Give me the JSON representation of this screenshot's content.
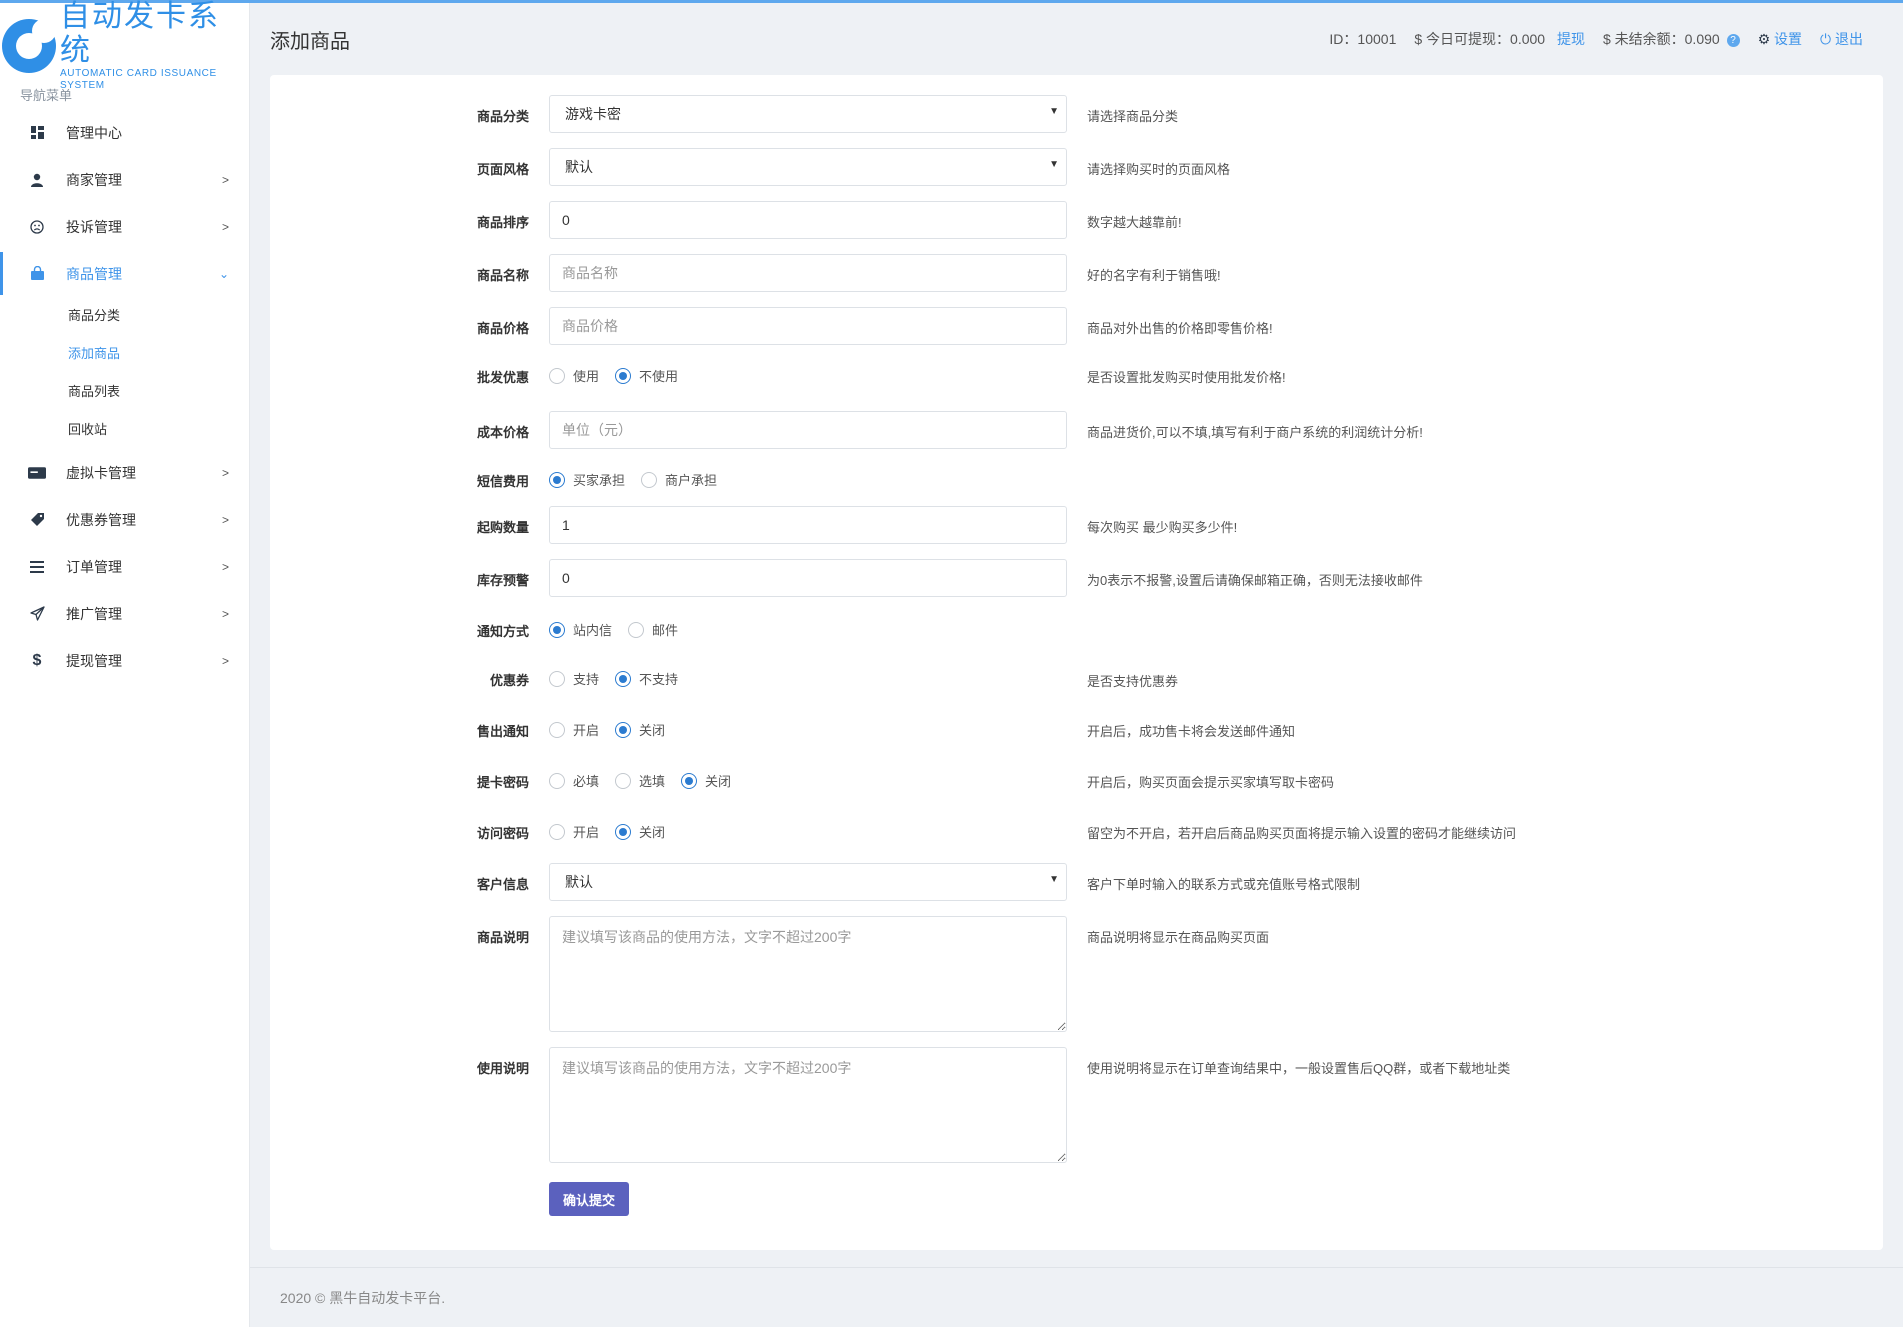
{
  "brand": {
    "title": "自动发卡系统",
    "subtitle": "AUTOMATIC CARD ISSUANCE SYSTEM"
  },
  "sidebar": {
    "heading": "导航菜单",
    "items": [
      {
        "label": "管理中心",
        "icon": "dashboard-icon"
      },
      {
        "label": "商家管理",
        "icon": "user-icon"
      },
      {
        "label": "投诉管理",
        "icon": "frown-icon"
      },
      {
        "label": "商品管理",
        "icon": "shopping-bag-icon",
        "active": true
      },
      {
        "label": "虚拟卡管理",
        "icon": "card-icon"
      },
      {
        "label": "优惠券管理",
        "icon": "ticket-icon"
      },
      {
        "label": "订单管理",
        "icon": "list-icon"
      },
      {
        "label": "推广管理",
        "icon": "send-icon"
      },
      {
        "label": "提现管理",
        "icon": "dollar-icon"
      }
    ],
    "subitems": [
      "商品分类",
      "添加商品",
      "商品列表",
      "回收站"
    ]
  },
  "header": {
    "title": "添加商品",
    "id_text": "ID：10001",
    "withdrawable_text": "$ 今日可提现：0.000",
    "withdraw_link": "提现",
    "unsettled_text": "$ 未结余额：0.090",
    "help_mark": "?",
    "settings_label": "设置",
    "logout_label": "退出"
  },
  "form": {
    "category": {
      "label": "商品分类",
      "value": "游戏卡密",
      "help": "请选择商品分类"
    },
    "theme": {
      "label": "页面风格",
      "value": "默认",
      "help": "请选择购买时的页面风格"
    },
    "sort": {
      "label": "商品排序",
      "value": "0",
      "help": "数字越大越靠前!"
    },
    "name": {
      "label": "商品名称",
      "placeholder": "商品名称",
      "help": "好的名字有利于销售哦!"
    },
    "price": {
      "label": "商品价格",
      "placeholder": "商品价格",
      "help": "商品对外出售的价格即零售价格!"
    },
    "wholesale": {
      "label": "批发优惠",
      "options": [
        "使用",
        "不使用"
      ],
      "selected": "不使用",
      "help": "是否设置批发购买时使用批发价格!"
    },
    "cost": {
      "label": "成本价格",
      "placeholder": "单位（元）",
      "help": "商品进货价,可以不填,填写有利于商户系统的利润统计分析!"
    },
    "sms_fee": {
      "label": "短信费用",
      "options": [
        "买家承担",
        "商户承担"
      ],
      "selected": "买家承担"
    },
    "min_qty": {
      "label": "起购数量",
      "value": "1",
      "help": "每次购买 最少购买多少件!"
    },
    "stock_alert": {
      "label": "库存预警",
      "value": "0",
      "help": "为0表示不报警,设置后请确保邮箱正确，否则无法接收邮件"
    },
    "notify": {
      "label": "通知方式",
      "options": [
        "站内信",
        "邮件"
      ],
      "selected": "站内信"
    },
    "coupon": {
      "label": "优惠券",
      "options": [
        "支持",
        "不支持"
      ],
      "selected": "不支持",
      "help": "是否支持优惠券"
    },
    "sold_notify": {
      "label": "售出通知",
      "options": [
        "开启",
        "关闭"
      ],
      "selected": "关闭",
      "help": "开启后，成功售卡将会发送邮件通知"
    },
    "pickup_pwd": {
      "label": "提卡密码",
      "options": [
        "必填",
        "选填",
        "关闭"
      ],
      "selected": "关闭",
      "help": "开启后，购买页面会提示买家填写取卡密码"
    },
    "access_pwd": {
      "label": "访问密码",
      "options": [
        "开启",
        "关闭"
      ],
      "selected": "关闭",
      "help": "留空为不开启，若开启后商品购买页面将提示输入设置的密码才能继续访问"
    },
    "customer_info": {
      "label": "客户信息",
      "value": "默认",
      "help": "客户下单时输入的联系方式或充值账号格式限制"
    },
    "description": {
      "label": "商品说明",
      "placeholder": "建议填写该商品的使用方法，文字不超过200字",
      "help": "商品说明将显示在商品购买页面"
    },
    "usage": {
      "label": "使用说明",
      "placeholder": "建议填写该商品的使用方法，文字不超过200字",
      "help": "使用说明将显示在订单查询结果中，一般设置售后QQ群，或者下载地址类"
    },
    "submit_label": "确认提交"
  },
  "footer": {
    "text": "2020 © 黑牛自动发卡平台."
  }
}
